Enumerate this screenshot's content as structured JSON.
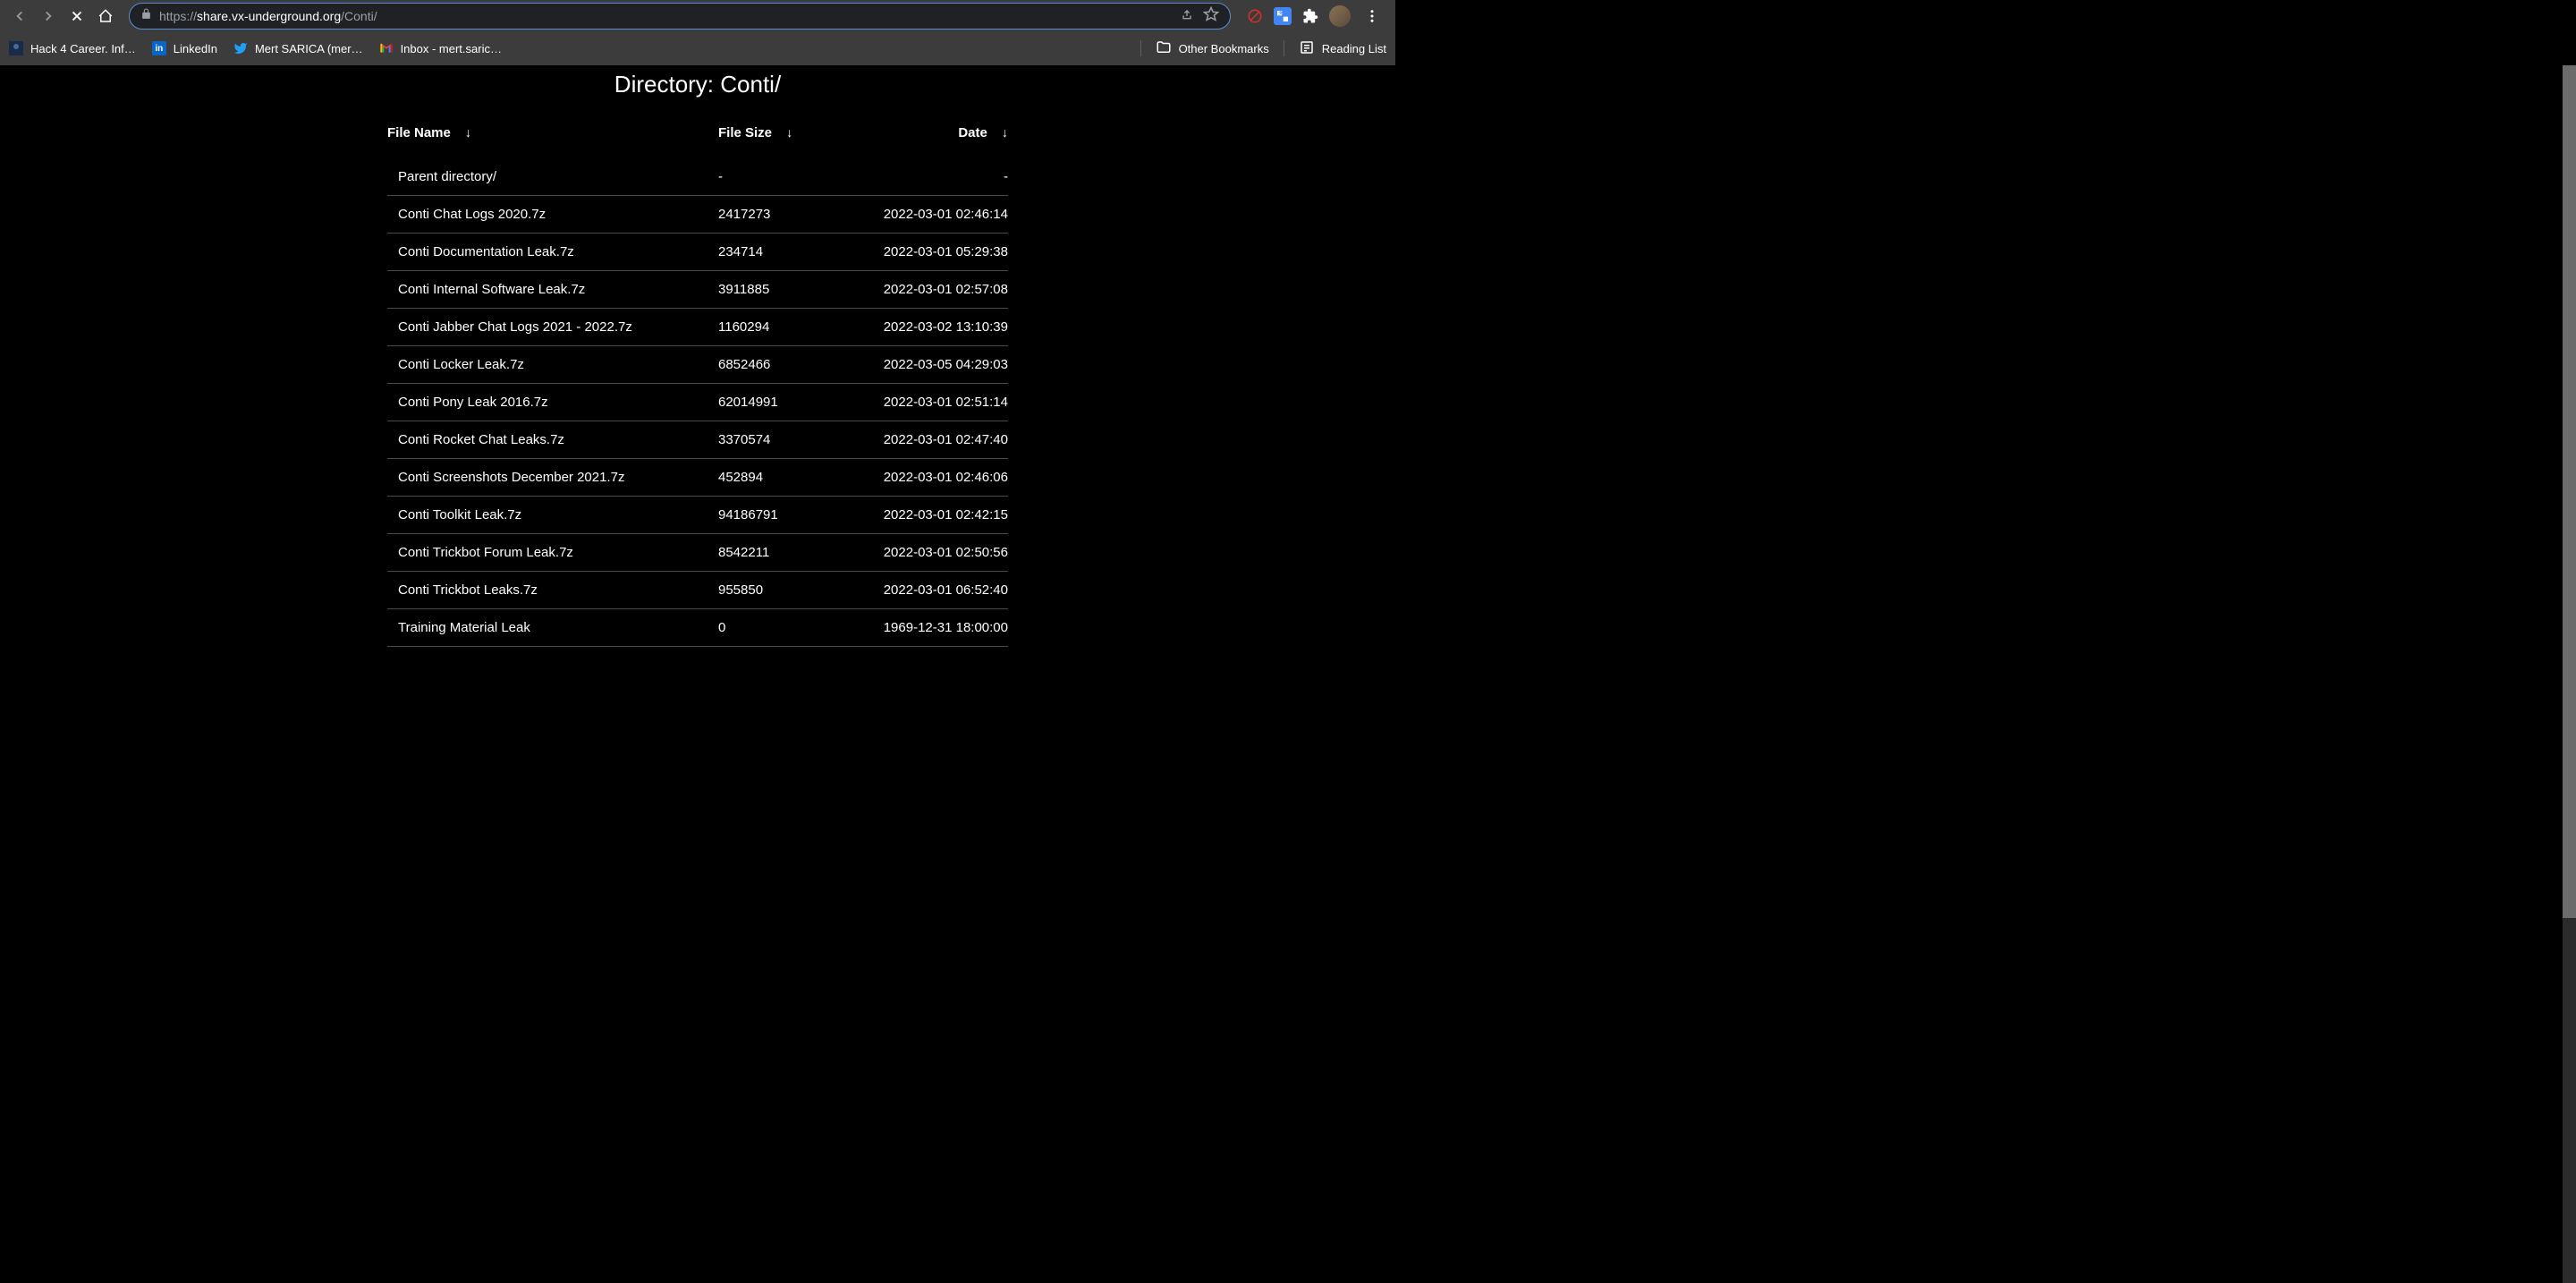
{
  "browser": {
    "url_full": "https://share.vx-underground.org/Conti/",
    "url_prefix": "https://",
    "url_domain": "share.vx-underground.org",
    "url_path": "/Conti/"
  },
  "bookmarks": {
    "items": [
      {
        "label": "Hack 4 Career. Inf…",
        "icon": "hack"
      },
      {
        "label": "LinkedIn",
        "icon": "linkedin"
      },
      {
        "label": "Mert SARICA (mer…",
        "icon": "twitter"
      },
      {
        "label": "Inbox - mert.saric…",
        "icon": "gmail"
      }
    ],
    "other_bookmarks": "Other Bookmarks",
    "reading_list": "Reading List"
  },
  "page": {
    "title": "Directory: Conti/",
    "headers": {
      "name": "File Name",
      "size": "File Size",
      "date": "Date"
    },
    "sort_arrow": "↓",
    "rows": [
      {
        "name": "Parent directory/",
        "size": "-",
        "date": "-"
      },
      {
        "name": "Conti Chat Logs 2020.7z",
        "size": "2417273",
        "date": "2022-03-01 02:46:14"
      },
      {
        "name": "Conti Documentation Leak.7z",
        "size": "234714",
        "date": "2022-03-01 05:29:38"
      },
      {
        "name": "Conti Internal Software Leak.7z",
        "size": "3911885",
        "date": "2022-03-01 02:57:08"
      },
      {
        "name": "Conti Jabber Chat Logs 2021 - 2022.7z",
        "size": "1160294",
        "date": "2022-03-02 13:10:39"
      },
      {
        "name": "Conti Locker Leak.7z",
        "size": "6852466",
        "date": "2022-03-05 04:29:03"
      },
      {
        "name": "Conti Pony Leak 2016.7z",
        "size": "62014991",
        "date": "2022-03-01 02:51:14"
      },
      {
        "name": "Conti Rocket Chat Leaks.7z",
        "size": "3370574",
        "date": "2022-03-01 02:47:40"
      },
      {
        "name": "Conti Screenshots December 2021.7z",
        "size": "452894",
        "date": "2022-03-01 02:46:06"
      },
      {
        "name": "Conti Toolkit Leak.7z",
        "size": "94186791",
        "date": "2022-03-01 02:42:15"
      },
      {
        "name": "Conti Trickbot Forum Leak.7z",
        "size": "8542211",
        "date": "2022-03-01 02:50:56"
      },
      {
        "name": "Conti Trickbot Leaks.7z",
        "size": "955850",
        "date": "2022-03-01 06:52:40"
      },
      {
        "name": "Training Material Leak",
        "size": "0",
        "date": "1969-12-31 18:00:00"
      }
    ]
  }
}
